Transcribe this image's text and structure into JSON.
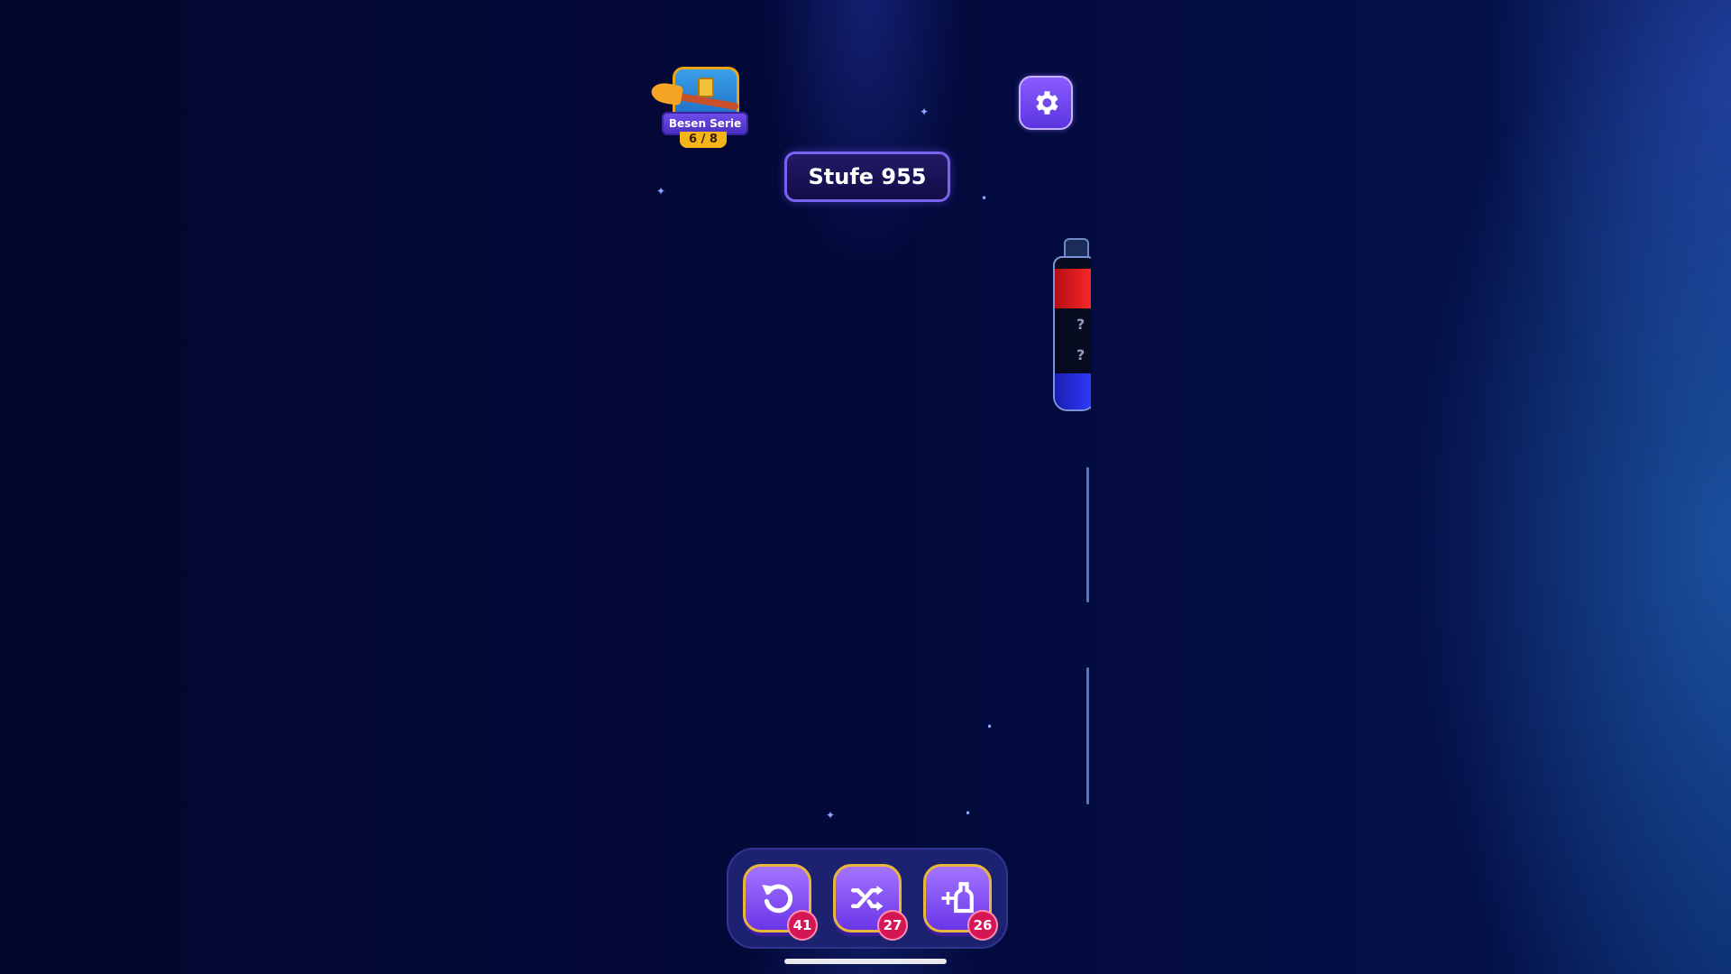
{
  "hud": {
    "chest": {
      "title": "Besen Serie",
      "progress": "6 / 8"
    },
    "level": {
      "label": "Stufe 955"
    },
    "settings_icon": "gear-icon"
  },
  "bottle": {
    "segments": [
      "red",
      "?",
      "?",
      "blue"
    ],
    "colors": {
      "red": "#e51d24",
      "blue": "#2233ff"
    }
  },
  "tools": [
    {
      "name": "undo",
      "icon": "undo-icon",
      "count": "41"
    },
    {
      "name": "shuffle",
      "icon": "shuffle-icon",
      "count": "27"
    },
    {
      "name": "add-bottle",
      "icon": "add-bottle-icon",
      "count": "26"
    }
  ],
  "colors": {
    "background": "#03093a",
    "accent": "#6a35e8",
    "badge": "#d41654"
  }
}
